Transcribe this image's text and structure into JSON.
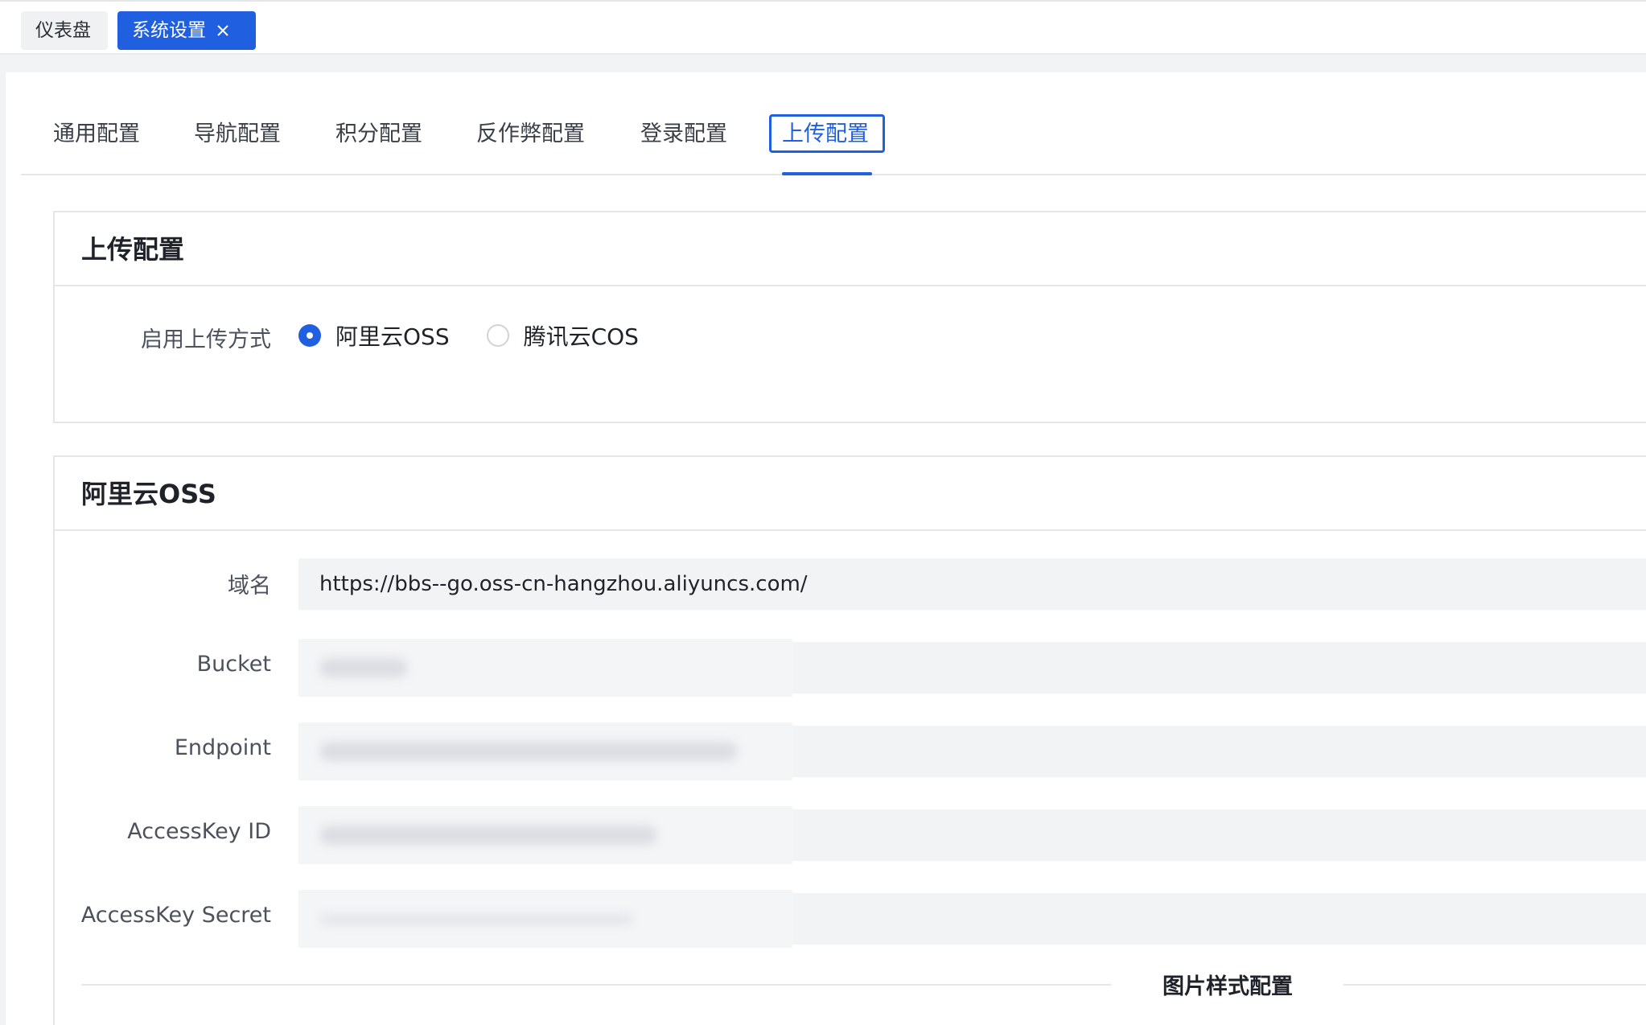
{
  "top_tabs": [
    {
      "label": "仪表盘",
      "active": false
    },
    {
      "label": "系统设置",
      "active": true
    }
  ],
  "settings_tabs": [
    {
      "label": "通用配置"
    },
    {
      "label": "导航配置"
    },
    {
      "label": "积分配置"
    },
    {
      "label": "反作弊配置"
    },
    {
      "label": "登录配置"
    },
    {
      "label": "上传配置",
      "active": true
    }
  ],
  "upload_card": {
    "title": "上传配置",
    "method_label": "启用上传方式",
    "options": [
      {
        "label": "阿里云OSS",
        "checked": true
      },
      {
        "label": "腾讯云COS",
        "checked": false
      }
    ]
  },
  "oss_card": {
    "title": "阿里云OSS",
    "fields": [
      {
        "label": "域名",
        "value": "https://bbs--go.oss-cn-hangzhou.aliyuncs.com/"
      },
      {
        "label": "Bucket",
        "value": ""
      },
      {
        "label": "Endpoint",
        "value": ""
      },
      {
        "label": "AccessKey ID",
        "value": ""
      },
      {
        "label": "AccessKey Secret",
        "value": ""
      }
    ],
    "divider": "图片样式配置"
  },
  "colors": {
    "accent": "#1f5fe0",
    "input_bg": "#f2f3f5",
    "border": "#e4e6eb"
  },
  "icons": {
    "close": "close-icon"
  }
}
